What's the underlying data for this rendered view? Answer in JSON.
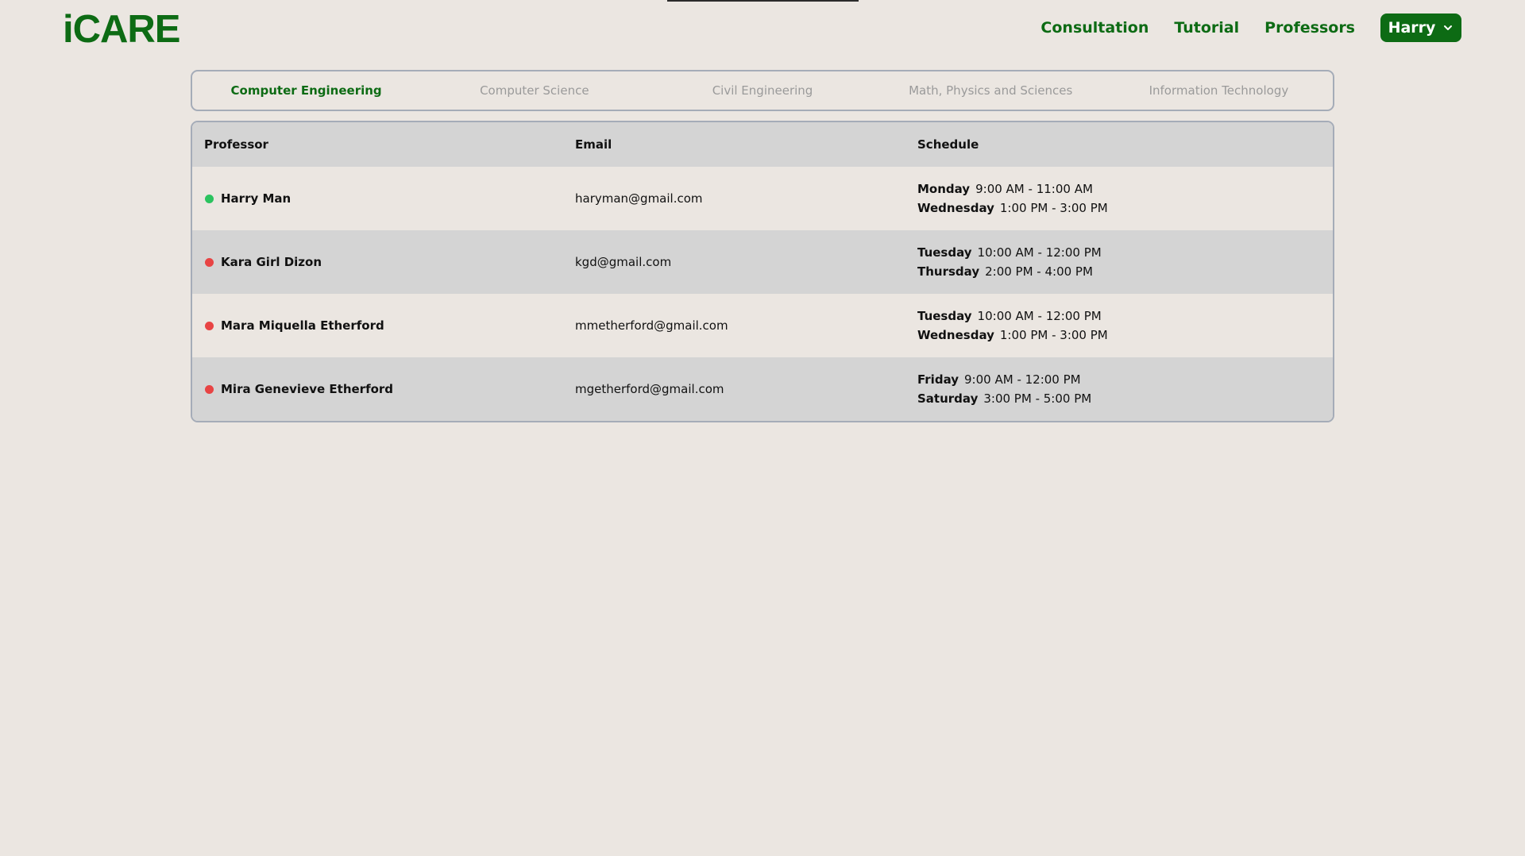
{
  "app": {
    "logo": "iCARE",
    "brand_color": "#0d6b14"
  },
  "nav": {
    "links": [
      "Consultation",
      "Tutorial",
      "Professors"
    ],
    "user": {
      "label": "Harry",
      "icon": "chevron-down-icon"
    }
  },
  "tabs": [
    {
      "label": "Computer Engineering",
      "active": true
    },
    {
      "label": "Computer Science",
      "active": false
    },
    {
      "label": "Civil Engineering",
      "active": false
    },
    {
      "label": "Math, Physics and Sciences",
      "active": false
    },
    {
      "label": "Information Technology",
      "active": false
    }
  ],
  "table": {
    "headers": {
      "professor": "Professor",
      "email": "Email",
      "schedule": "Schedule"
    },
    "status_colors": {
      "online": "#2bc35f",
      "offline": "#e84444"
    },
    "rows": [
      {
        "name": "Harry Man",
        "status": "online",
        "email": "haryman@gmail.com",
        "schedule": [
          {
            "day": "Monday",
            "time": "9:00 AM - 11:00 AM"
          },
          {
            "day": "Wednesday",
            "time": "1:00 PM - 3:00 PM"
          }
        ]
      },
      {
        "name": "Kara Girl Dizon",
        "status": "offline",
        "email": "kgd@gmail.com",
        "schedule": [
          {
            "day": "Tuesday",
            "time": "10:00 AM - 12:00 PM"
          },
          {
            "day": "Thursday",
            "time": "2:00 PM - 4:00 PM"
          }
        ]
      },
      {
        "name": "Mara Miquella Etherford",
        "status": "offline",
        "email": "mmetherford@gmail.com",
        "schedule": [
          {
            "day": "Tuesday",
            "time": "10:00 AM - 12:00 PM"
          },
          {
            "day": "Wednesday",
            "time": "1:00 PM - 3:00 PM"
          }
        ]
      },
      {
        "name": "Mira Genevieve Etherford",
        "status": "offline",
        "email": "mgetherford@gmail.com",
        "schedule": [
          {
            "day": "Friday",
            "time": "9:00 AM - 12:00 PM"
          },
          {
            "day": "Saturday",
            "time": "3:00 PM - 5:00 PM"
          }
        ]
      }
    ]
  }
}
